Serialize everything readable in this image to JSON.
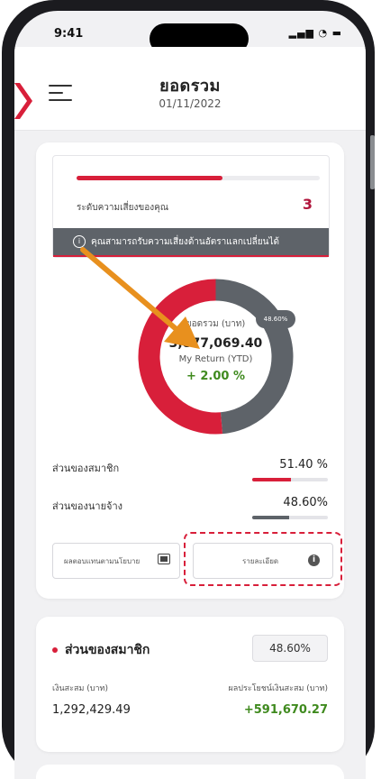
{
  "status": {
    "time": "9:41",
    "icons": "▂▄▆ ◔ ▬"
  },
  "header": {
    "title": "ยอดรวม",
    "date": "01/11/2022"
  },
  "risk": {
    "level_fraction": 0.6,
    "label": "ระดับความเสี่ยงของคุณ",
    "value": "3",
    "banner": "คุณสามารถรับความเสี่ยงด้านอัตราแลกเปลี่ยนได้"
  },
  "summary": {
    "label": "ยอดรวม (บาท)",
    "amount": "3,877,069.40",
    "return_label": "My Return (YTD)",
    "return_value": "+ 2.00 %",
    "donut_badge": "48.60%"
  },
  "chart_data": {
    "type": "pie",
    "categories": [
      "ส่วนของสมาชิก",
      "ส่วนของนายจ้าง"
    ],
    "values": [
      51.4,
      48.6
    ],
    "colors": [
      "#d81f3a",
      "#5e6369"
    ]
  },
  "shares": [
    {
      "label": "ส่วนของสมาชิก",
      "value": "51.40 %",
      "fraction": 0.514,
      "color": "#d81f3a"
    },
    {
      "label": "ส่วนของนายจ้าง",
      "value": "48.60%",
      "fraction": 0.486,
      "color": "#5e6369"
    }
  ],
  "buttons": {
    "policy_label": "ผลตอบแทนตามนโยบาย",
    "details_label": "รายละเอียด",
    "details_icon": "i"
  },
  "member": {
    "title": "ส่วนของสมาชิก",
    "badge": "48.60%",
    "accum_label": "เงินสะสม (บาท)",
    "gain_label": "ผลประโยชน์เงินสะสม (บาท)",
    "accum_value": "1,292,429.49",
    "gain_value": "+591,670.27"
  },
  "colors": {
    "accent": "#d81f3a",
    "gray": "#5e6369",
    "positive": "#3f8a1e",
    "arrow": "#e8901e"
  }
}
